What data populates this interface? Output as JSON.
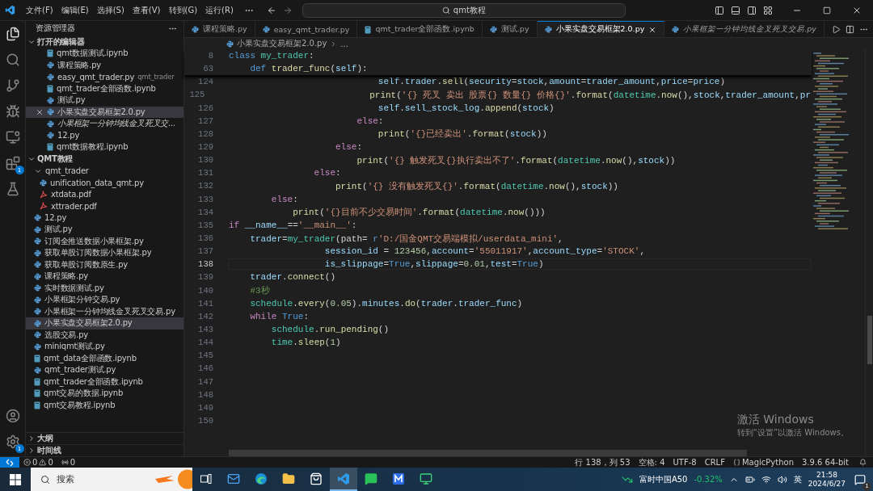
{
  "title_bar": {
    "menus": [
      "文件(F)",
      "编辑(E)",
      "选择(S)",
      "查看(V)",
      "转到(G)",
      "运行(R)"
    ],
    "search": "qmt教程"
  },
  "activity_bar": {
    "extensions_badge": "1",
    "settings_badge": "1"
  },
  "sidebar": {
    "title": "资源管理器",
    "open_editors": {
      "label": "打开的编辑器",
      "expanded": true,
      "items": [
        {
          "name": "qmt数据测试.ipynb",
          "kind": "notebook",
          "selected": false,
          "preview": false
        },
        {
          "name": "课程策略.py",
          "kind": "python",
          "selected": false,
          "preview": false
        },
        {
          "name": "easy_qmt_trader.py",
          "description": "qmt_trader",
          "kind": "python",
          "selected": false,
          "preview": false
        },
        {
          "name": "qmt_trader全部函数.ipynb",
          "kind": "notebook",
          "selected": false,
          "preview": false
        },
        {
          "name": "测试.py",
          "kind": "python",
          "selected": false,
          "preview": false
        },
        {
          "name": "小果实盘交易框架2.0.py",
          "kind": "python",
          "selected": true,
          "preview": false
        },
        {
          "name": "小果框架一分钟均线金叉死叉交...",
          "kind": "python",
          "selected": false,
          "preview": true
        },
        {
          "name": "12.py",
          "kind": "python",
          "selected": false,
          "preview": false
        },
        {
          "name": "qmt数据教程.ipynb",
          "kind": "notebook",
          "selected": false,
          "preview": false
        }
      ]
    },
    "folder": {
      "label": "QMT教程",
      "expanded": true,
      "children": [
        {
          "name": "qmt_trader",
          "kind": "folder",
          "expanded": true,
          "selected": false,
          "children": [
            {
              "name": "unification_data_qmt.py",
              "kind": "python",
              "selected": false
            },
            {
              "name": "xtdata.pdf",
              "kind": "pdf",
              "selected": false
            },
            {
              "name": "xttrader.pdf",
              "kind": "pdf",
              "selected": false
            }
          ]
        },
        {
          "name": "12.py",
          "kind": "python",
          "selected": false
        },
        {
          "name": "测试.py",
          "kind": "python",
          "selected": false
        },
        {
          "name": "订阅全推送数据小果框架.py",
          "kind": "python",
          "selected": false
        },
        {
          "name": "获取单股订阅数据小果框架.py",
          "kind": "python",
          "selected": false
        },
        {
          "name": "获取单股订阅数原生.py",
          "kind": "python",
          "selected": false
        },
        {
          "name": "课程策略.py",
          "kind": "python",
          "selected": false
        },
        {
          "name": "实时数据测试.py",
          "kind": "python",
          "selected": false
        },
        {
          "name": "小果框架分钟交易.py",
          "kind": "python",
          "selected": false
        },
        {
          "name": "小果框架一分钟均线金叉死叉交易.py",
          "kind": "python",
          "selected": false
        },
        {
          "name": "小果实盘交易框架2.0.py",
          "kind": "python",
          "selected": true
        },
        {
          "name": "选股交易.py",
          "kind": "python",
          "selected": false
        },
        {
          "name": "miniqmt测试.py",
          "kind": "python",
          "selected": false
        },
        {
          "name": "qmt_data全部函数.ipynb",
          "kind": "notebook",
          "selected": false
        },
        {
          "name": "qmt_trader测试.py",
          "kind": "python",
          "selected": false
        },
        {
          "name": "qmt_trader全部函数.ipynb",
          "kind": "notebook",
          "selected": false
        },
        {
          "name": "qmt交易的数据.ipynb",
          "kind": "notebook",
          "selected": false
        },
        {
          "name": "qmt交易教程.ipynb",
          "kind": "notebook",
          "selected": false
        }
      ]
    },
    "panels": [
      {
        "label": "大纲",
        "expanded": false
      },
      {
        "label": "时间线",
        "expanded": false
      }
    ]
  },
  "editor": {
    "tabs": [
      {
        "label": "课程策略.py",
        "kind": "python",
        "selected": false,
        "preview": false
      },
      {
        "label": "easy_qmt_trader.py",
        "kind": "python",
        "selected": false,
        "preview": false
      },
      {
        "label": "qmt_trader全部函数.ipynb",
        "kind": "notebook",
        "selected": false,
        "preview": false
      },
      {
        "label": "测试.py",
        "kind": "python",
        "selected": false,
        "preview": false
      },
      {
        "label": "小果实盘交易框架2.0.py",
        "kind": "python",
        "selected": true,
        "preview": false
      },
      {
        "label": "小果框架一分钟均线金叉死叉交易.py",
        "kind": "python",
        "selected": false,
        "preview": true
      }
    ],
    "breadcrumb": [
      "小果实盘交易框架2.0.py",
      "..."
    ],
    "sticky_lines": [
      {
        "number": "8",
        "tokens": [
          {
            "kind": "kw",
            "text": "class "
          },
          {
            "kind": "cls",
            "text": "my_trader"
          },
          {
            "kind": "p",
            "text": ":"
          }
        ]
      },
      {
        "number": "63",
        "tokens": [
          {
            "kind": "kw",
            "text": "    def "
          },
          {
            "kind": "fn",
            "text": "trader_func"
          },
          {
            "kind": "p",
            "text": "("
          },
          {
            "kind": "var",
            "text": "self"
          },
          {
            "kind": "p",
            "text": "):"
          }
        ]
      }
    ],
    "lines": [
      {
        "number": "124",
        "current": false,
        "tokens": [
          {
            "kind": "var",
            "text": "                            self"
          },
          {
            "kind": "p",
            "text": "."
          },
          {
            "kind": "var",
            "text": "trader"
          },
          {
            "kind": "p",
            "text": "."
          },
          {
            "kind": "fn",
            "text": "sell"
          },
          {
            "kind": "p",
            "text": "("
          },
          {
            "kind": "var",
            "text": "security"
          },
          {
            "kind": "p",
            "text": "="
          },
          {
            "kind": "var",
            "text": "stock"
          },
          {
            "kind": "p",
            "text": ","
          },
          {
            "kind": "var",
            "text": "amount"
          },
          {
            "kind": "p",
            "text": "="
          },
          {
            "kind": "var",
            "text": "trader_amount"
          },
          {
            "kind": "p",
            "text": ","
          },
          {
            "kind": "var",
            "text": "price"
          },
          {
            "kind": "p",
            "text": "="
          },
          {
            "kind": "var",
            "text": "price"
          },
          {
            "kind": "p",
            "text": ")"
          }
        ]
      },
      {
        "number": "125",
        "current": false,
        "tokens": [
          {
            "kind": "fn",
            "text": "                            print"
          },
          {
            "kind": "p",
            "text": "("
          },
          {
            "kind": "str",
            "text": "'{} 死叉 卖出 股票{} 数量{} 价格{}'"
          },
          {
            "kind": "p",
            "text": "."
          },
          {
            "kind": "fn",
            "text": "format"
          },
          {
            "kind": "p",
            "text": "("
          },
          {
            "kind": "cls",
            "text": "datetime"
          },
          {
            "kind": "p",
            "text": "."
          },
          {
            "kind": "fn",
            "text": "now"
          },
          {
            "kind": "p",
            "text": "(),"
          },
          {
            "kind": "var",
            "text": "stock"
          },
          {
            "kind": "p",
            "text": ","
          },
          {
            "kind": "var",
            "text": "trader_amount"
          },
          {
            "kind": "p",
            "text": ","
          },
          {
            "kind": "var",
            "text": "pr"
          }
        ]
      },
      {
        "number": "126",
        "current": false,
        "tokens": [
          {
            "kind": "var",
            "text": "                            self"
          },
          {
            "kind": "p",
            "text": "."
          },
          {
            "kind": "var",
            "text": "sell_stock_log"
          },
          {
            "kind": "p",
            "text": "."
          },
          {
            "kind": "fn",
            "text": "append"
          },
          {
            "kind": "p",
            "text": "("
          },
          {
            "kind": "var",
            "text": "stock"
          },
          {
            "kind": "p",
            "text": ")"
          }
        ]
      },
      {
        "number": "127",
        "current": false,
        "tokens": [
          {
            "kind": "ctl",
            "text": "                        else"
          },
          {
            "kind": "p",
            "text": ":"
          }
        ]
      },
      {
        "number": "128",
        "current": false,
        "tokens": [
          {
            "kind": "fn",
            "text": "                            print"
          },
          {
            "kind": "p",
            "text": "("
          },
          {
            "kind": "str",
            "text": "'{}已经卖出'"
          },
          {
            "kind": "p",
            "text": "."
          },
          {
            "kind": "fn",
            "text": "format"
          },
          {
            "kind": "p",
            "text": "("
          },
          {
            "kind": "var",
            "text": "stock"
          },
          {
            "kind": "p",
            "text": "))"
          }
        ]
      },
      {
        "number": "129",
        "current": false,
        "tokens": [
          {
            "kind": "ctl",
            "text": "                    else"
          },
          {
            "kind": "p",
            "text": ":"
          }
        ]
      },
      {
        "number": "130",
        "current": false,
        "tokens": [
          {
            "kind": "fn",
            "text": "                        print"
          },
          {
            "kind": "p",
            "text": "("
          },
          {
            "kind": "str",
            "text": "'{} 触发死叉{}执行卖出不了'"
          },
          {
            "kind": "p",
            "text": "."
          },
          {
            "kind": "fn",
            "text": "format"
          },
          {
            "kind": "p",
            "text": "("
          },
          {
            "kind": "cls",
            "text": "datetime"
          },
          {
            "kind": "p",
            "text": "."
          },
          {
            "kind": "fn",
            "text": "now"
          },
          {
            "kind": "p",
            "text": "(),"
          },
          {
            "kind": "var",
            "text": "stock"
          },
          {
            "kind": "p",
            "text": "))"
          }
        ]
      },
      {
        "number": "131",
        "current": false,
        "tokens": [
          {
            "kind": "ctl",
            "text": "                else"
          },
          {
            "kind": "p",
            "text": ":"
          }
        ]
      },
      {
        "number": "132",
        "current": false,
        "tokens": [
          {
            "kind": "fn",
            "text": "                    print"
          },
          {
            "kind": "p",
            "text": "("
          },
          {
            "kind": "str",
            "text": "'{} 没有触发死叉{}'"
          },
          {
            "kind": "p",
            "text": "."
          },
          {
            "kind": "fn",
            "text": "format"
          },
          {
            "kind": "p",
            "text": "("
          },
          {
            "kind": "cls",
            "text": "datetime"
          },
          {
            "kind": "p",
            "text": "."
          },
          {
            "kind": "fn",
            "text": "now"
          },
          {
            "kind": "p",
            "text": "(),"
          },
          {
            "kind": "var",
            "text": "stock"
          },
          {
            "kind": "p",
            "text": "))"
          }
        ]
      },
      {
        "number": "133",
        "current": false,
        "tokens": [
          {
            "kind": "ctl",
            "text": "        else"
          },
          {
            "kind": "p",
            "text": ":"
          }
        ]
      },
      {
        "number": "134",
        "current": false,
        "tokens": [
          {
            "kind": "fn",
            "text": "            print"
          },
          {
            "kind": "p",
            "text": "("
          },
          {
            "kind": "str",
            "text": "'{}目前不少交易时间'"
          },
          {
            "kind": "p",
            "text": "."
          },
          {
            "kind": "fn",
            "text": "format"
          },
          {
            "kind": "p",
            "text": "("
          },
          {
            "kind": "cls",
            "text": "datetime"
          },
          {
            "kind": "p",
            "text": "."
          },
          {
            "kind": "fn",
            "text": "now"
          },
          {
            "kind": "p",
            "text": "()))"
          }
        ]
      },
      {
        "number": "135",
        "current": false,
        "tokens": [
          {
            "kind": "ctl",
            "text": "if "
          },
          {
            "kind": "var",
            "text": "__name__"
          },
          {
            "kind": "p",
            "text": "=="
          },
          {
            "kind": "str",
            "text": "'__main__'"
          },
          {
            "kind": "p",
            "text": ":"
          }
        ]
      },
      {
        "number": "136",
        "current": false,
        "tokens": [
          {
            "kind": "var",
            "text": "    trader"
          },
          {
            "kind": "p",
            "text": "="
          },
          {
            "kind": "cls",
            "text": "my_trader"
          },
          {
            "kind": "p",
            "text": "(path= "
          },
          {
            "kind": "kw",
            "text": "r"
          },
          {
            "kind": "str",
            "text": "'D:/国金QMT交易端模拟/userdata_mini'"
          },
          {
            "kind": "p",
            "text": ","
          }
        ]
      },
      {
        "number": "137",
        "current": false,
        "tokens": [
          {
            "kind": "var",
            "text": "                  session_id"
          },
          {
            "kind": "p",
            "text": " = "
          },
          {
            "kind": "num",
            "text": "123456"
          },
          {
            "kind": "p",
            "text": ","
          },
          {
            "kind": "var",
            "text": "account"
          },
          {
            "kind": "p",
            "text": "="
          },
          {
            "kind": "str",
            "text": "'55011917'"
          },
          {
            "kind": "p",
            "text": ","
          },
          {
            "kind": "var",
            "text": "account_type"
          },
          {
            "kind": "p",
            "text": "="
          },
          {
            "kind": "str",
            "text": "'STOCK'"
          },
          {
            "kind": "p",
            "text": ","
          }
        ]
      },
      {
        "number": "138",
        "current": true,
        "tokens": [
          {
            "kind": "var",
            "text": "                  is_slippage"
          },
          {
            "kind": "p",
            "text": "="
          },
          {
            "kind": "kw",
            "text": "True"
          },
          {
            "kind": "p",
            "text": ","
          },
          {
            "kind": "var",
            "text": "slippage"
          },
          {
            "kind": "p",
            "text": "="
          },
          {
            "kind": "num",
            "text": "0.01"
          },
          {
            "kind": "p",
            "text": ","
          },
          {
            "kind": "var",
            "text": "test"
          },
          {
            "kind": "p",
            "text": "="
          },
          {
            "kind": "kw",
            "text": "True"
          },
          {
            "kind": "p",
            "text": ")"
          }
        ]
      },
      {
        "number": "139",
        "current": false,
        "tokens": [
          {
            "kind": "var",
            "text": "    trader"
          },
          {
            "kind": "p",
            "text": "."
          },
          {
            "kind": "fn",
            "text": "connect"
          },
          {
            "kind": "p",
            "text": "()"
          }
        ]
      },
      {
        "number": "140",
        "current": false,
        "tokens": [
          {
            "kind": "cm",
            "text": "    #3秒"
          }
        ]
      },
      {
        "number": "141",
        "current": false,
        "tokens": [
          {
            "kind": "cls",
            "text": "    schedule"
          },
          {
            "kind": "p",
            "text": "."
          },
          {
            "kind": "fn",
            "text": "every"
          },
          {
            "kind": "p",
            "text": "("
          },
          {
            "kind": "num",
            "text": "0.05"
          },
          {
            "kind": "p",
            "text": ")."
          },
          {
            "kind": "var",
            "text": "minutes"
          },
          {
            "kind": "p",
            "text": "."
          },
          {
            "kind": "fn",
            "text": "do"
          },
          {
            "kind": "p",
            "text": "("
          },
          {
            "kind": "var",
            "text": "trader"
          },
          {
            "kind": "p",
            "text": "."
          },
          {
            "kind": "var",
            "text": "trader_func"
          },
          {
            "kind": "p",
            "text": ")"
          }
        ]
      },
      {
        "number": "142",
        "current": false,
        "tokens": [
          {
            "kind": "ctl",
            "text": "    while "
          },
          {
            "kind": "kw",
            "text": "True"
          },
          {
            "kind": "p",
            "text": ":"
          }
        ]
      },
      {
        "number": "143",
        "current": false,
        "tokens": [
          {
            "kind": "cls",
            "text": "        schedule"
          },
          {
            "kind": "p",
            "text": "."
          },
          {
            "kind": "fn",
            "text": "run_pending"
          },
          {
            "kind": "p",
            "text": "()"
          }
        ]
      },
      {
        "number": "144",
        "current": false,
        "tokens": [
          {
            "kind": "cls",
            "text": "        time"
          },
          {
            "kind": "p",
            "text": "."
          },
          {
            "kind": "fn",
            "text": "sleep"
          },
          {
            "kind": "p",
            "text": "("
          },
          {
            "kind": "num",
            "text": "1"
          },
          {
            "kind": "p",
            "text": ")"
          }
        ]
      },
      {
        "number": "145",
        "current": false
      },
      {
        "number": "146",
        "current": false
      },
      {
        "number": "147",
        "current": false
      },
      {
        "number": "148",
        "current": false
      },
      {
        "number": "149",
        "current": false
      },
      {
        "number": "150",
        "current": false
      }
    ]
  },
  "activation": {
    "title": "激活 Windows",
    "text": "转到“设置”以激活 Windows。"
  },
  "status_bar": {
    "errors": "0",
    "warnings": "0",
    "ports": "0",
    "right": [
      {
        "kind": "text",
        "text": "行 138，列 53"
      },
      {
        "kind": "text",
        "text": "空格: 4"
      },
      {
        "kind": "text",
        "text": "UTF-8"
      },
      {
        "kind": "text",
        "text": "CRLF"
      },
      {
        "kind": "language",
        "text": "MagicPython"
      },
      {
        "kind": "text",
        "text": "3.9.6 64-bit"
      }
    ]
  },
  "taskbar": {
    "search": "搜索",
    "apps": [
      {
        "kind": "taskview",
        "selected": false
      },
      {
        "kind": "mail",
        "selected": false
      },
      {
        "kind": "edge",
        "selected": false
      },
      {
        "kind": "explorer",
        "selected": false
      },
      {
        "kind": "store",
        "selected": false
      },
      {
        "kind": "vscode",
        "selected": true
      },
      {
        "kind": "wechat",
        "selected": false
      },
      {
        "kind": "mapp",
        "selected": false
      },
      {
        "kind": "remote",
        "selected": false
      }
    ],
    "stock": {
      "name": "富时中国A50",
      "change": "-0.32%"
    },
    "ime": "英",
    "time": "21:58",
    "date": "2024/6/27",
    "notifications": "1"
  }
}
